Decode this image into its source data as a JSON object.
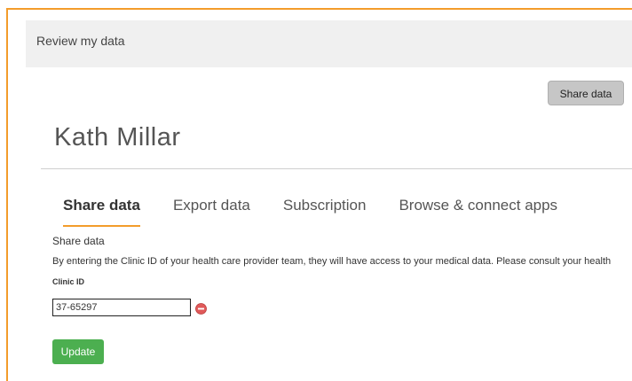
{
  "header": {
    "title": "Review my data"
  },
  "toolbar": {
    "share_label": "Share data"
  },
  "profile": {
    "name": "Kath Millar"
  },
  "tabs": [
    {
      "label": "Share data",
      "active": true
    },
    {
      "label": "Export data",
      "active": false
    },
    {
      "label": "Subscription",
      "active": false
    },
    {
      "label": "Browse & connect apps",
      "active": false
    }
  ],
  "share": {
    "section_title": "Share data",
    "description": "By entering the Clinic ID of your health care provider team, they will have access to your medical data. Please consult your health",
    "field_label": "Clinic ID",
    "clinic_id_value": "37-65297",
    "remove_icon": "remove-circle-icon",
    "update_label": "Update"
  },
  "colors": {
    "accent": "#f39c2b",
    "update_button": "#4caf50",
    "remove_icon": "#e05a5a",
    "header_bg": "#f0f0f0"
  }
}
